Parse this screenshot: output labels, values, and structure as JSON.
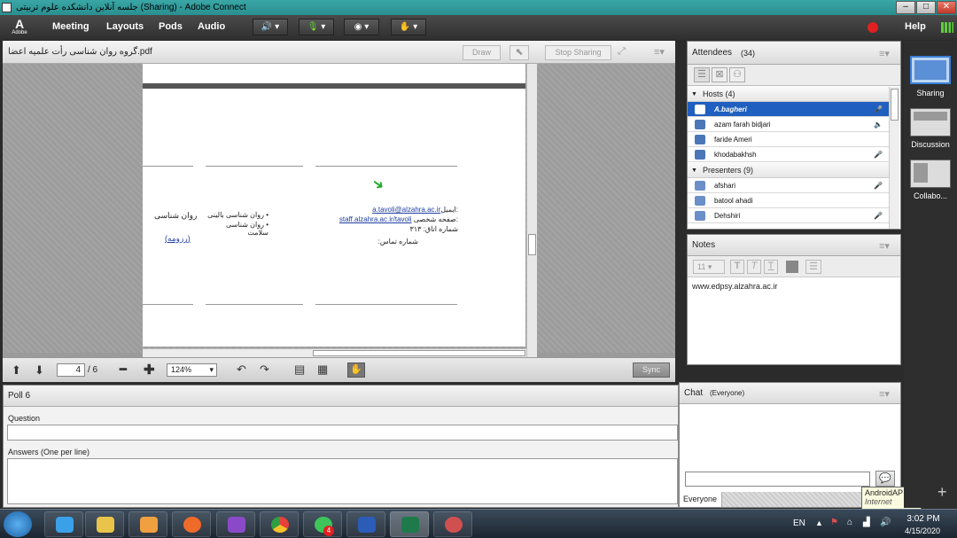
{
  "window": {
    "title": "جلسه آنلاین دانشکده علوم تربیتی (Sharing) - Adobe Connect"
  },
  "menubar": {
    "logo_label": "Adobe",
    "items": [
      "Meeting",
      "Layouts",
      "Pods",
      "Audio"
    ],
    "help": "Help"
  },
  "share_pod": {
    "filename": "گروه روان شناسی رأت علمیه اعضا.pdf",
    "draw": "Draw",
    "stop_sharing": "Stop Sharing",
    "page_current": "4",
    "page_total": "/ 6",
    "zoom": "124%",
    "sync": "Sync",
    "doc": {
      "col1_title": "روان شناسی",
      "col1_link": "(رزومه)",
      "col2_item1": "روان شناسی بالینی",
      "col2_item2": "روان شناسی سلامت",
      "email_label": "ایمیل:",
      "email": "a.tavoli@alzahra.ac.ir",
      "homepage_label": "صفحه شخصی:",
      "homepage": "staff.alzahra.ac.ir/tavoli",
      "room": "۳۱۳ :شماره اتاق",
      "phone": ":شماره تماس"
    }
  },
  "attendees": {
    "title": "Attendees",
    "count": "(34)",
    "hosts_label": "Hosts (4)",
    "presenters_label": "Presenters (9)",
    "hosts": [
      "A.bagheri",
      "azam farah bidjari",
      "faride Ameri",
      "khodabakhsh"
    ],
    "presenters": [
      "afshari",
      "batool ahadi",
      "Dehshiri"
    ]
  },
  "notes": {
    "title": "Notes",
    "font_size": "11",
    "content": "www.edpsy.alzahra.ac.ir"
  },
  "poll": {
    "title": "Poll 6",
    "question_label": "Question",
    "answers_label": "Answers (One per line)"
  },
  "chat": {
    "title": "Chat",
    "scope": "(Everyone)",
    "recipient": "Everyone"
  },
  "layouts": [
    "Sharing",
    "Discussion",
    "Collabo..."
  ],
  "tooltip": {
    "line1": "AndroidAP",
    "line2": "Internet access"
  },
  "taskbar": {
    "lang": "EN",
    "time": "3:02 PM",
    "date": "4/15/2020",
    "whatsapp_badge": "4"
  },
  "colors": {
    "accent": "#1f5fbf",
    "titlebar": "#2a8f90",
    "record": "#e02020"
  }
}
